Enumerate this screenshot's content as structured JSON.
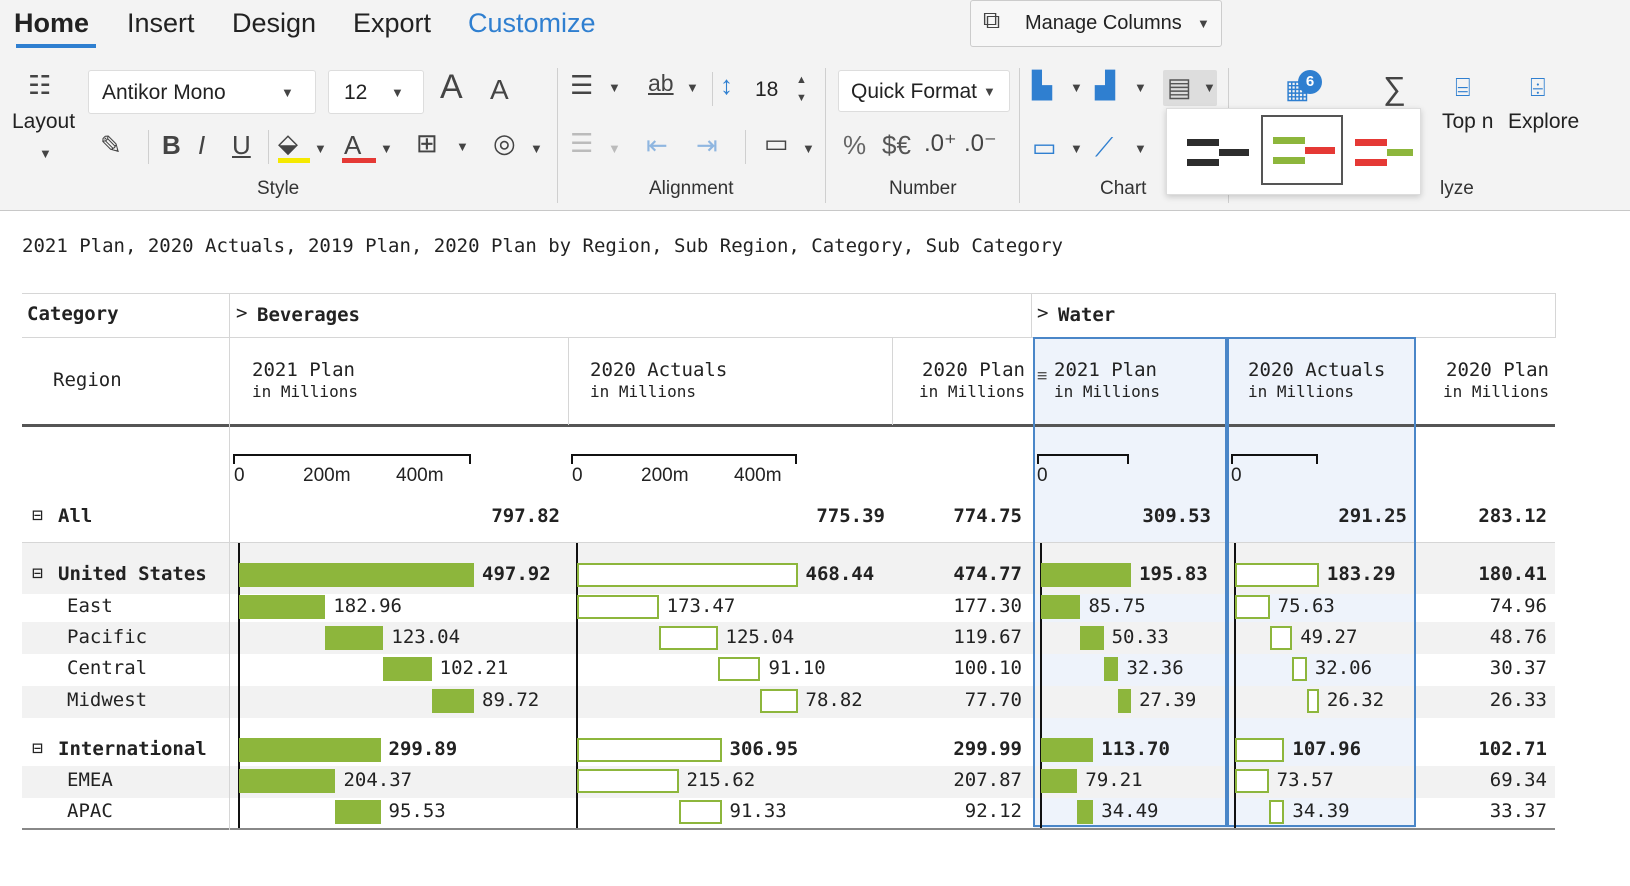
{
  "ribbon": {
    "tabs": [
      {
        "label": "Home",
        "active": true
      },
      {
        "label": "Insert"
      },
      {
        "label": "Design"
      },
      {
        "label": "Export"
      },
      {
        "label": "Customize"
      }
    ],
    "manage_columns": "Manage Columns",
    "layout_label": "Layout",
    "font_name": "Antikor Mono",
    "font_size": "12",
    "row_height": "18",
    "quick_format": "Quick Format",
    "top_n": "Top n",
    "explore": "Explore",
    "badge_count": "6",
    "groups": {
      "style": "Style",
      "alignment": "Alignment",
      "number": "Number",
      "chart": "Chart",
      "analyze_partial": "lyze"
    },
    "popup_options": [
      "dark-bars",
      "green-red-bars",
      "red-green-bars"
    ],
    "accent_color": "#2f7fd0"
  },
  "report": {
    "subtitle": "2021 Plan, 2020 Actuals, 2019 Plan, 2020 Plan by Region, Sub Region, Category, Sub Category",
    "header": {
      "category_label": "Category",
      "region_label": "Region",
      "beverages": "Beverages",
      "water": "Water"
    },
    "columns": [
      {
        "title": "2021 Plan",
        "unit": "in Millions"
      },
      {
        "title": "2020 Actuals",
        "unit": "in Millions"
      },
      {
        "title": "2020 Plan",
        "unit": "in Millions"
      },
      {
        "title": "2021 Plan",
        "unit": "in Millions"
      },
      {
        "title": "2020 Actuals",
        "unit": "in Millions"
      },
      {
        "title": "2020 Plan",
        "unit": "in Millions"
      }
    ],
    "axis_ticks": [
      "0",
      "200m",
      "400m"
    ],
    "axis_ticks_water": [
      "0"
    ],
    "bar_color": "#8db63c",
    "rows": [
      {
        "label": "All",
        "level": 0,
        "collapsible": true,
        "values": [
          "797.82",
          "775.39",
          "774.75",
          "309.53",
          "291.25",
          "283.12"
        ]
      },
      {
        "label": "United States",
        "level": 0,
        "collapsible": true,
        "values": [
          "497.92",
          "468.44",
          "474.77",
          "195.83",
          "183.29",
          "180.41"
        ]
      },
      {
        "label": "East",
        "level": 1,
        "values": [
          "182.96",
          "173.47",
          "177.30",
          "85.75",
          "75.63",
          "74.96"
        ]
      },
      {
        "label": "Pacific",
        "level": 1,
        "values": [
          "123.04",
          "125.04",
          "119.67",
          "50.33",
          "49.27",
          "48.76"
        ]
      },
      {
        "label": "Central",
        "level": 1,
        "values": [
          "102.21",
          "91.10",
          "100.10",
          "32.36",
          "32.06",
          "30.37"
        ]
      },
      {
        "label": "Midwest",
        "level": 1,
        "values": [
          "89.72",
          "78.82",
          "77.70",
          "27.39",
          "26.32",
          "26.33"
        ]
      },
      {
        "label": "International",
        "level": 0,
        "collapsible": true,
        "values": [
          "299.89",
          "306.95",
          "299.99",
          "113.70",
          "107.96",
          "102.71"
        ]
      },
      {
        "label": "EMEA",
        "level": 1,
        "values": [
          "204.37",
          "215.62",
          "207.87",
          "79.21",
          "73.57",
          "69.34"
        ]
      },
      {
        "label": "APAC",
        "level": 1,
        "values": [
          "95.53",
          "91.33",
          "92.12",
          "34.49",
          "34.39",
          "33.37"
        ]
      }
    ]
  }
}
